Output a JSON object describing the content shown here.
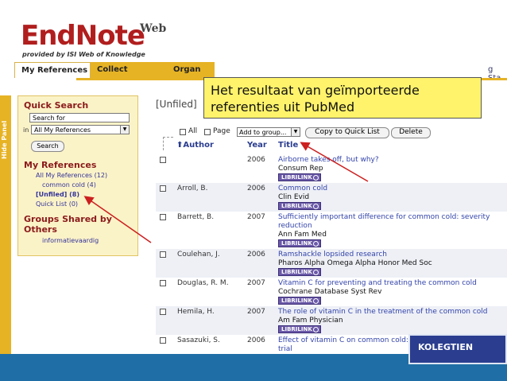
{
  "logo": {
    "main": "EndNote",
    "web": "Web",
    "sub": "provided by ISI Web of Knowledge"
  },
  "tabs": {
    "my_references": "My References",
    "collect": "Collect",
    "organize": "Organ",
    "right_partial": "g Sta"
  },
  "hide_panel": "Hide Panel",
  "left_panel": {
    "quick_search_heading": "Quick Search",
    "search_placeholder": "Search for",
    "in_label": "in",
    "scope_selected": "All My References",
    "search_button": "Search",
    "my_refs_heading": "My References",
    "links": [
      "All My References (12)",
      "common cold (4)",
      "[Unfiled] (8)",
      "Quick List (0)"
    ],
    "groups_heading": "Groups Shared by Others",
    "group_items": [
      "informatievaardig"
    ]
  },
  "main": {
    "title": "[Unfiled]",
    "toolbar": {
      "all": "All",
      "page": "Page",
      "add_to_group": "Add to group...",
      "copy_quick_list": "Copy to Quick List",
      "delete": "Delete"
    },
    "columns": {
      "author": "Author",
      "year": "Year",
      "title": "Title"
    },
    "librilink_label": "LIBRILINK",
    "rows": [
      {
        "author": "",
        "year": "2006",
        "title": "Airborne takes off, but why?",
        "journal": "Consum Rep"
      },
      {
        "author": "Arroll, B.",
        "year": "2006",
        "title": "Common cold",
        "journal": "Clin Evid"
      },
      {
        "author": "Barrett, B.",
        "year": "2007",
        "title": "Sufficiently important difference for common cold: severity reduction",
        "journal": "Ann Fam Med"
      },
      {
        "author": "Coulehan, J.",
        "year": "2006",
        "title": "Ramshackle lopsided research",
        "journal": "Pharos Alpha Omega Alpha Honor Med Soc"
      },
      {
        "author": "Douglas, R. M.",
        "year": "2007",
        "title": "Vitamin C for preventing and treating the common cold",
        "journal": "Cochrane Database Syst Rev"
      },
      {
        "author": "Hemila, H.",
        "year": "2007",
        "title": "The role of vitamin C in the treatment of the common cold",
        "journal": "Am Fam Physician"
      },
      {
        "author": "Sasazuki, S.",
        "year": "2006",
        "title": "Effect of vitamin C on common cold: randomized controlled trial",
        "journal": ""
      }
    ]
  },
  "callout": {
    "line1": "Het resultaat van geïmporteerde",
    "line2": "referenties uit PubMed"
  },
  "bottom_box_text": "KOLEGTIEN",
  "colors": {
    "accent_yellow": "#e6b325",
    "logo_red": "#b11e1e",
    "link_blue": "#3344aa",
    "bottom_blue": "#1f6fa6",
    "callout_yellow": "#fff36b",
    "arrow_red": "#cc1f1f"
  }
}
